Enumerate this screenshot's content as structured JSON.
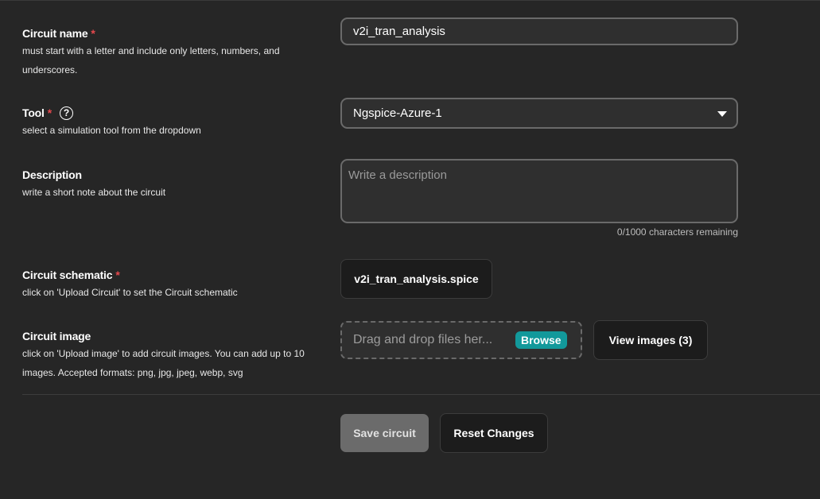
{
  "fields": {
    "name": {
      "title": "Circuit name",
      "required": "*",
      "help": "must start with a letter and include only letters, numbers, and underscores.",
      "value": "v2i_tran_analysis"
    },
    "tool": {
      "title": "Tool",
      "required": "*",
      "help_icon": "?",
      "help": "select a simulation tool from the dropdown",
      "selected": "Ngspice-Azure-1"
    },
    "description": {
      "title": "Description",
      "help": "write a short note about the circuit",
      "placeholder": "Write a description",
      "counter": "0/1000 characters remaining"
    },
    "schematic": {
      "title": "Circuit schematic",
      "required": "*",
      "help": "click on 'Upload Circuit' to set the Circuit schematic",
      "file_label": "v2i_tran_analysis.spice"
    },
    "image": {
      "title": "Circuit image",
      "help": "click on 'Upload image' to add circuit images. You can add up to 10 images. Accepted formats: png, jpg, jpeg, webp, svg",
      "dropzone_text": "Drag and drop files her...",
      "browse_label": "Browse",
      "view_images_label": "View images (3)"
    }
  },
  "actions": {
    "save_label": "Save circuit",
    "reset_label": "Reset Changes"
  },
  "colors": {
    "background": "#262626",
    "required": "#e5484d",
    "accent": "#12999b",
    "disabled_button": "#6b6b6b"
  }
}
